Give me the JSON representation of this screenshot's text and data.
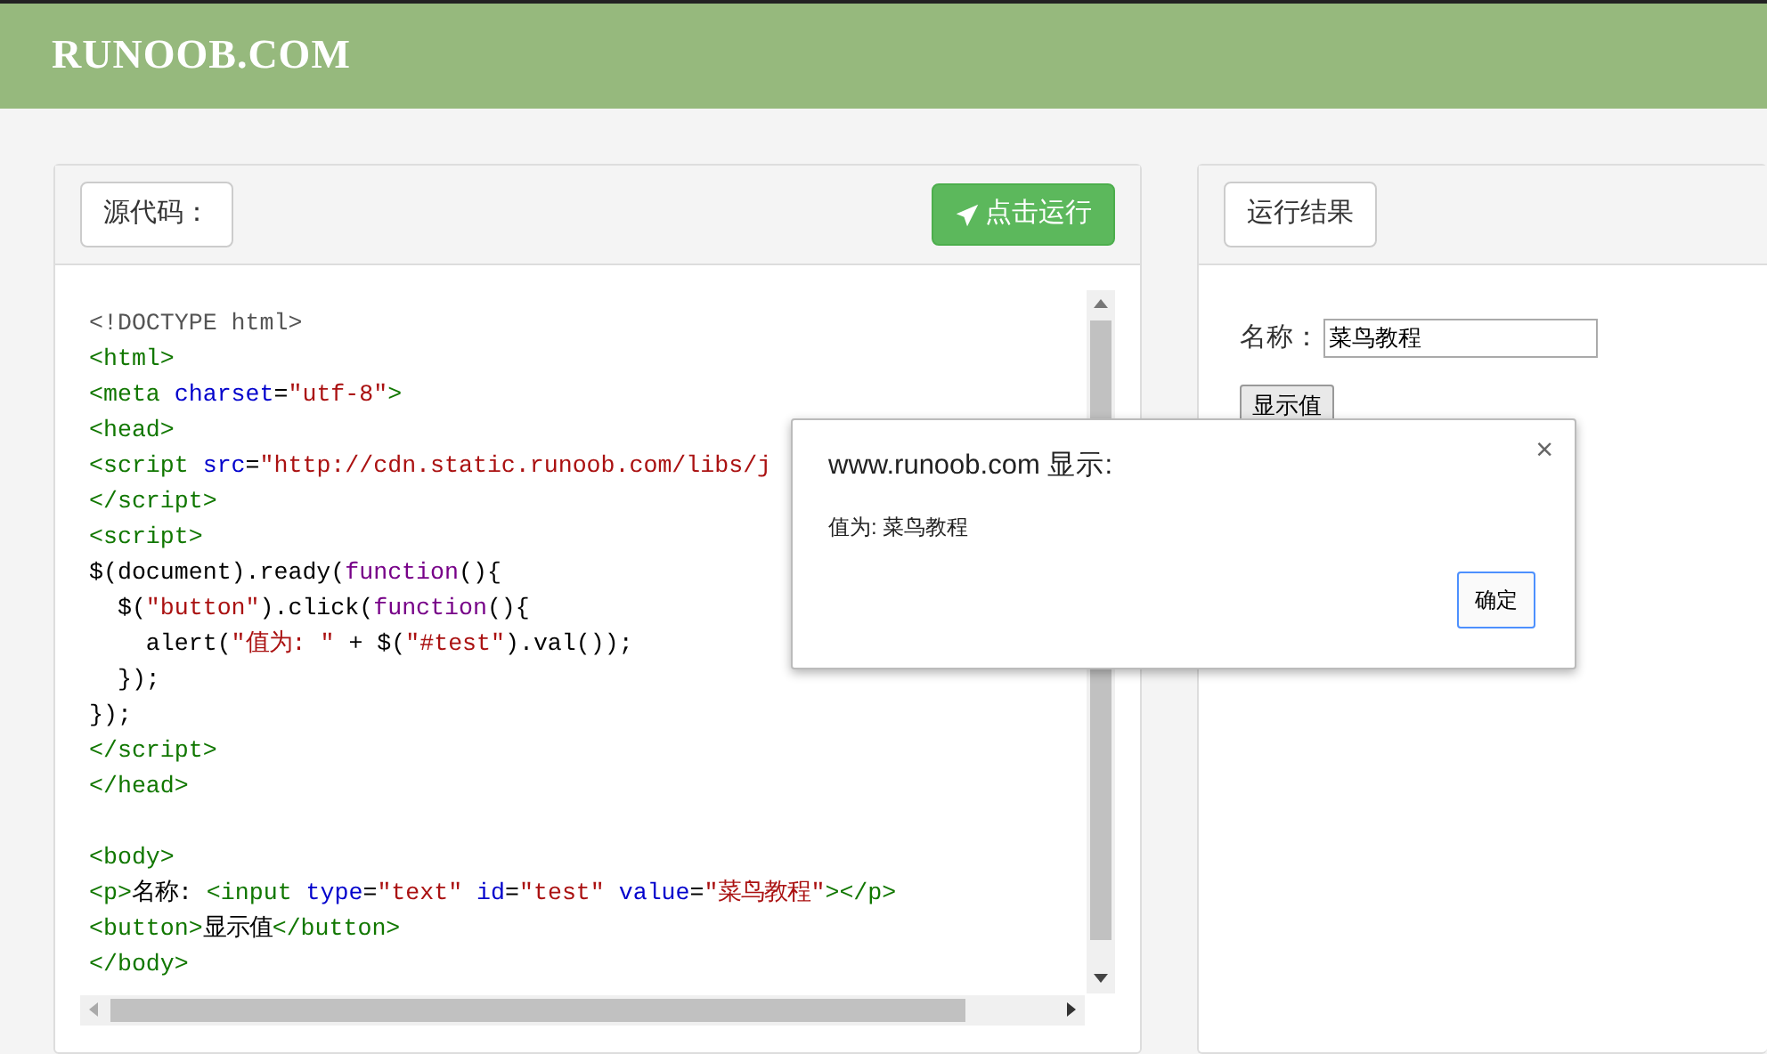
{
  "header": {
    "logo": "RUNOOB.COM"
  },
  "source_panel": {
    "label": "源代码：",
    "run_button": "点击运行",
    "code_lines": [
      {
        "kind": "code",
        "tokens": [
          {
            "kind": "doctype",
            "text": "<!DOCTYPE html>"
          }
        ]
      },
      {
        "kind": "code",
        "tokens": [
          {
            "kind": "tag",
            "text": "<html>"
          }
        ]
      },
      {
        "kind": "code",
        "tokens": [
          {
            "kind": "tag",
            "text": "<meta "
          },
          {
            "kind": "attr",
            "text": "charset"
          },
          {
            "kind": "plain",
            "text": "="
          },
          {
            "kind": "string",
            "text": "\"utf-8\""
          },
          {
            "kind": "tag",
            "text": ">"
          }
        ]
      },
      {
        "kind": "code",
        "tokens": [
          {
            "kind": "tag",
            "text": "<head>"
          }
        ]
      },
      {
        "kind": "code",
        "tokens": [
          {
            "kind": "tag",
            "text": "<script "
          },
          {
            "kind": "attr",
            "text": "src"
          },
          {
            "kind": "plain",
            "text": "="
          },
          {
            "kind": "string",
            "text": "\"http://cdn.static.runoob.com/libs/j"
          }
        ]
      },
      {
        "kind": "code",
        "tokens": [
          {
            "kind": "tag",
            "text": "</script>"
          }
        ]
      },
      {
        "kind": "code",
        "tokens": [
          {
            "kind": "tag",
            "text": "<script>"
          }
        ]
      },
      {
        "kind": "code",
        "tokens": [
          {
            "kind": "plain",
            "text": "$(document).ready("
          },
          {
            "kind": "keyword",
            "text": "function"
          },
          {
            "kind": "plain",
            "text": "(){"
          }
        ]
      },
      {
        "kind": "code",
        "tokens": [
          {
            "kind": "plain",
            "text": "  $("
          },
          {
            "kind": "string",
            "text": "\"button\""
          },
          {
            "kind": "plain",
            "text": ").click("
          },
          {
            "kind": "keyword",
            "text": "function"
          },
          {
            "kind": "plain",
            "text": "(){"
          }
        ]
      },
      {
        "kind": "code",
        "tokens": [
          {
            "kind": "plain",
            "text": "    alert("
          },
          {
            "kind": "string",
            "text": "\"值为: \""
          },
          {
            "kind": "plain",
            "text": " + $("
          },
          {
            "kind": "string",
            "text": "\"#test\""
          },
          {
            "kind": "plain",
            "text": ").val());"
          }
        ]
      },
      {
        "kind": "code",
        "tokens": [
          {
            "kind": "plain",
            "text": "  });"
          }
        ]
      },
      {
        "kind": "code",
        "tokens": [
          {
            "kind": "plain",
            "text": "});"
          }
        ]
      },
      {
        "kind": "code",
        "tokens": [
          {
            "kind": "tag",
            "text": "</script>"
          }
        ]
      },
      {
        "kind": "code",
        "tokens": [
          {
            "kind": "tag",
            "text": "</head>"
          }
        ]
      },
      {
        "kind": "blank"
      },
      {
        "kind": "code",
        "tokens": [
          {
            "kind": "tag",
            "text": "<body>"
          }
        ]
      },
      {
        "kind": "code",
        "tokens": [
          {
            "kind": "tag",
            "text": "<p>"
          },
          {
            "kind": "plain",
            "text": "名称: "
          },
          {
            "kind": "tag",
            "text": "<input "
          },
          {
            "kind": "attr",
            "text": "type"
          },
          {
            "kind": "plain",
            "text": "="
          },
          {
            "kind": "string",
            "text": "\"text\" "
          },
          {
            "kind": "attr",
            "text": "id"
          },
          {
            "kind": "plain",
            "text": "="
          },
          {
            "kind": "string",
            "text": "\"test\" "
          },
          {
            "kind": "attr",
            "text": "value"
          },
          {
            "kind": "plain",
            "text": "="
          },
          {
            "kind": "string",
            "text": "\"菜鸟教程\""
          },
          {
            "kind": "tag",
            "text": "></p>"
          }
        ]
      },
      {
        "kind": "code",
        "tokens": [
          {
            "kind": "tag",
            "text": "<button>"
          },
          {
            "kind": "plain",
            "text": "显示值"
          },
          {
            "kind": "tag",
            "text": "</button>"
          }
        ]
      },
      {
        "kind": "code",
        "tokens": [
          {
            "kind": "tag",
            "text": "</body>"
          }
        ]
      }
    ]
  },
  "result_panel": {
    "label": "运行结果",
    "field_label": "名称：",
    "field_value": "菜鸟教程",
    "button": "显示值"
  },
  "alert": {
    "title": "www.runoob.com 显示:",
    "message": "值为: 菜鸟教程",
    "close": "×",
    "ok_button": "确定"
  }
}
